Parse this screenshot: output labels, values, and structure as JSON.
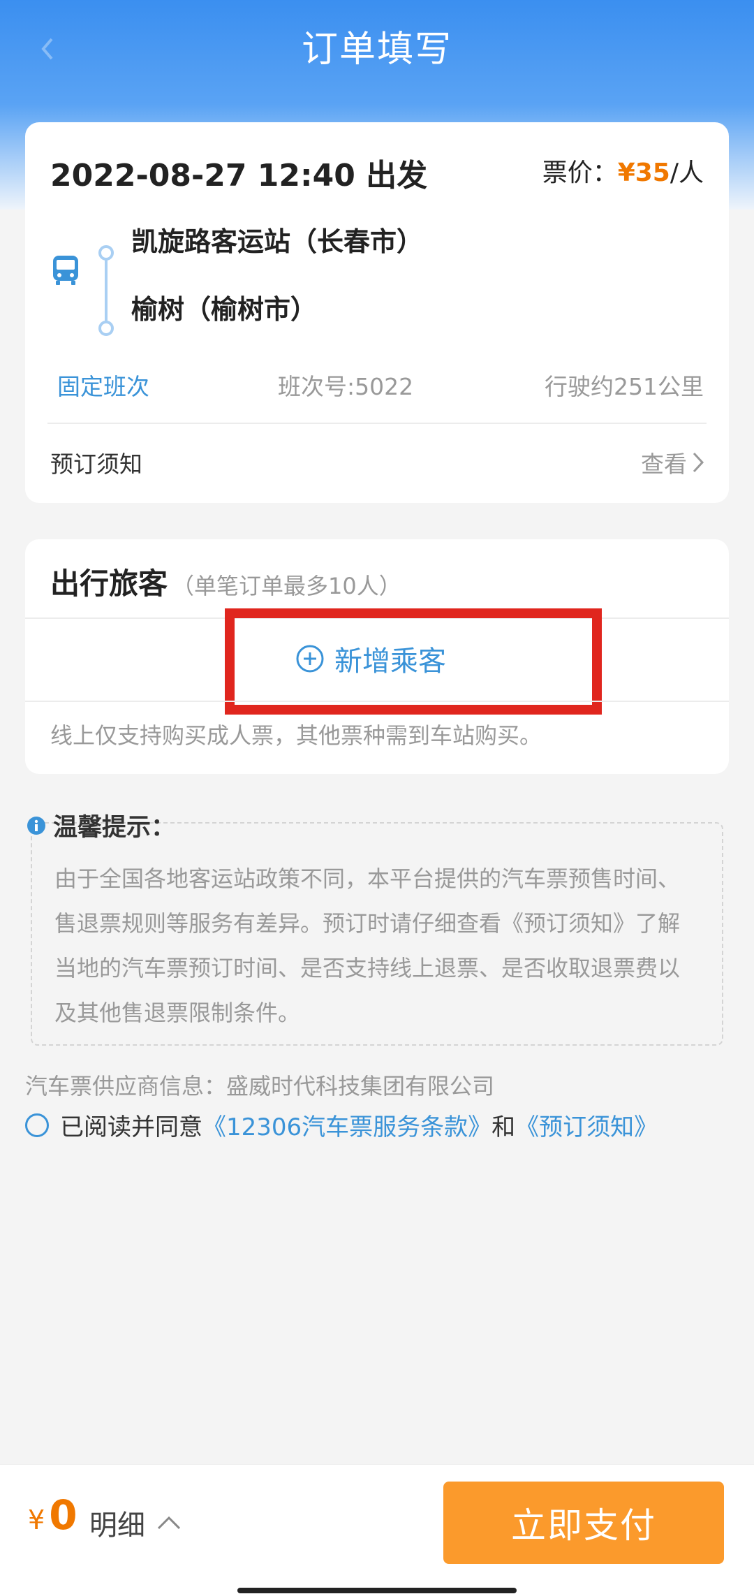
{
  "header": {
    "title": "订单填写"
  },
  "trip": {
    "depart": "2022-08-27 12:40 出发",
    "price_label": "票价：",
    "price_amount": "¥35",
    "price_unit": "/人",
    "from_station": "凯旋路客运站（长春市）",
    "to_station": "榆树（榆树市）",
    "tag": "固定班次",
    "trip_no": "班次号:5022",
    "distance": "行驶约251公里",
    "notice_label": "预订须知",
    "notice_action": "查看"
  },
  "passengers": {
    "title": "出行旅客",
    "note": "（单笔订单最多10人）",
    "add_label": "新增乘客",
    "online_note": "线上仅支持购买成人票，其他票种需到车站购买。"
  },
  "tips": {
    "title": "温馨提示：",
    "body": "由于全国各地客运站政策不同，本平台提供的汽车票预售时间、售退票规则等服务有差异。预订时请仔细查看《预订须知》了解当地的汽车票预订时间、是否支持线上退票、是否收取退票费以及其他售退票限制条件。"
  },
  "supplier": "汽车票供应商信息：盛威时代科技集团有限公司",
  "agreement": {
    "prefix": "已阅读并同意",
    "link1": "《12306汽车票服务条款》",
    "and": "和",
    "link2": "《预订须知》"
  },
  "footer": {
    "currency": "¥",
    "total": "0",
    "detail": "明细",
    "pay": "立即支付"
  },
  "colors": {
    "primary": "#3a93d8",
    "accent": "#f07800",
    "pay": "#fb9a2c",
    "highlight": "#e0261e"
  }
}
